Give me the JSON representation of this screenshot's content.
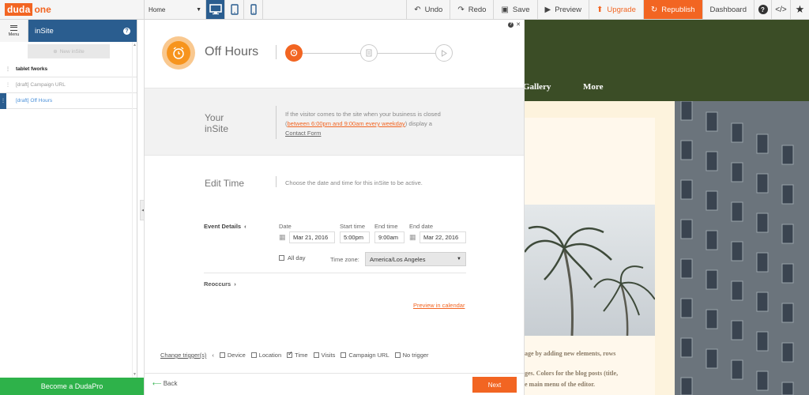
{
  "topbar": {
    "logo_brand": "duda",
    "logo_suffix": "one",
    "page_select": "Home",
    "undo": "Undo",
    "redo": "Redo",
    "save": "Save",
    "preview": "Preview",
    "upgrade": "Upgrade",
    "republish": "Republish",
    "dashboard": "Dashboard",
    "code_icon": "</>",
    "help": "?"
  },
  "left_panel": {
    "menu_label": "Menu",
    "title": "inSite",
    "new_insite": "New inSite",
    "items": [
      {
        "label": "tablet fworks",
        "state": "bold"
      },
      {
        "label": "[draft] Campaign URL",
        "state": "normal"
      },
      {
        "label": "[draft] Off Hours",
        "state": "active"
      }
    ],
    "become_pro": "Become a DudaPro"
  },
  "wizard": {
    "title": "Off Hours",
    "your_insite_label": "Your inSite",
    "your_insite_line1": "Your",
    "your_insite_line2": "inSite",
    "insite_text_before": "If the visitor comes to the site when your business is closed (",
    "insite_text_link": "between 6:00pm and 9:00am every weekday",
    "insite_text_mid": ") display a",
    "insite_text_end": "Contact Form",
    "edit_time_label": "Edit Time",
    "edit_time_desc": "Choose the date and time for this inSite to be active.",
    "event_details": "Event Details",
    "date_label": "Date",
    "date_value": "Mar 21, 2016",
    "start_time_label": "Start time",
    "start_time_value": "5:00pm",
    "end_time_label": "End time",
    "end_time_value": "9:00am",
    "end_date_label": "End date",
    "end_date_value": "Mar 22, 2016",
    "all_day": "All day",
    "timezone_label": "Time zone:",
    "timezone_value": "America/Los Angeles",
    "reoccurs": "Reoccurs",
    "preview_calendar": "Preview in calendar",
    "change_triggers": "Change trigger(s)",
    "triggers": [
      {
        "label": "Device",
        "checked": false
      },
      {
        "label": "Location",
        "checked": false
      },
      {
        "label": "Time",
        "checked": true
      },
      {
        "label": "Visits",
        "checked": false
      },
      {
        "label": "Campaign URL",
        "checked": false
      },
      {
        "label": "No trigger",
        "checked": false
      }
    ],
    "back": "Back",
    "next": "Next"
  },
  "preview": {
    "nav_gallery": "Gallery",
    "nav_more": "More",
    "text_line1": "age by adding new elements, rows",
    "text_line2": "ges. Colors for the blog posts (title,",
    "text_line3": "e main menu of the editor."
  },
  "colors": {
    "accent": "#f26522",
    "panel_blue": "#2a5d8f",
    "green_cta": "#2eb24a",
    "preview_header": "#3b4d26"
  }
}
